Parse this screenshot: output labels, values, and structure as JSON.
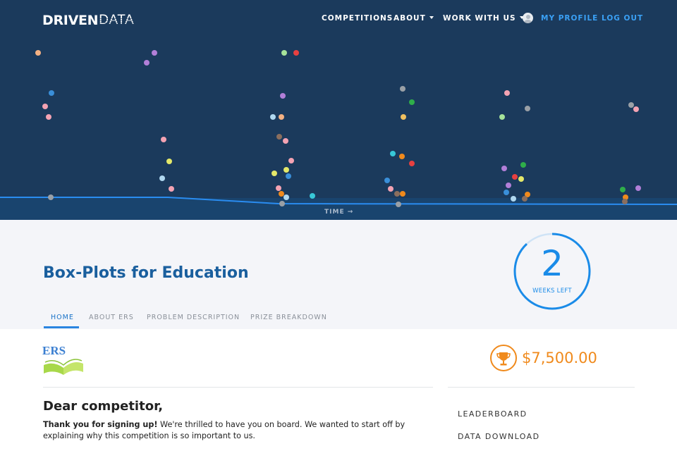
{
  "nav": {
    "logo_driven": "DRIVEN",
    "logo_data": "DATA",
    "competitions": "COMPETITIONS",
    "about": "ABOUT",
    "work_with_us": "WORK WITH US",
    "my_profile": "MY PROFILE",
    "log_out": "LOG OUT"
  },
  "hero": {
    "time_label": "TIME →"
  },
  "competition": {
    "title": "Box-Plots for Education",
    "countdown_value": "2",
    "countdown_label": "WEEKS LEFT",
    "countdown_fraction": 0.88
  },
  "tabs": [
    {
      "label": "HOME",
      "active": true
    },
    {
      "label": "ABOUT ERS",
      "active": false
    },
    {
      "label": "PROBLEM DESCRIPTION",
      "active": false
    },
    {
      "label": "PRIZE BREAKDOWN",
      "active": false
    }
  ],
  "sponsor": {
    "logo_text": "ERS"
  },
  "main": {
    "greeting": "Dear competitor,",
    "intro_bold": "Thank you for signing up!",
    "intro_rest": " We're thrilled to have you on board. We wanted to start off by explaining why this competition is so important to us."
  },
  "sidebar": {
    "prize": "$7,500.00",
    "links": [
      "LEADERBOARD",
      "DATA DOWNLOAD"
    ]
  },
  "colors": {
    "hero_bg": "#1b3a5c",
    "accent_blue": "#1a8be8",
    "prize_orange": "#f08a1c",
    "title_blue": "#1a5f9e"
  }
}
